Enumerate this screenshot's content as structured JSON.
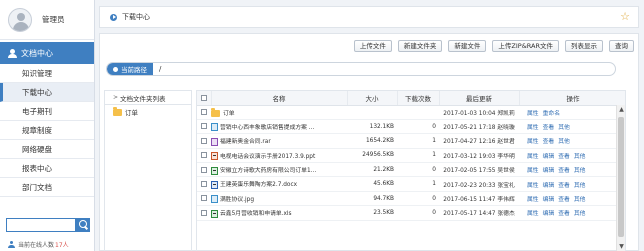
{
  "user": {
    "name": "管理员"
  },
  "sidebar": {
    "section_title": "文档中心",
    "items": [
      {
        "label": "知识管理",
        "active": false
      },
      {
        "label": "下载中心",
        "active": true
      },
      {
        "label": "电子期刊",
        "active": false
      },
      {
        "label": "规章制度",
        "active": false
      },
      {
        "label": "网络硬盘",
        "active": false
      },
      {
        "label": "报表中心",
        "active": false
      },
      {
        "label": "部门文档",
        "active": false
      }
    ],
    "search_placeholder": "",
    "online_label": "当前在线人数",
    "online_count": "17人"
  },
  "breadcrumb": {
    "title": "下载中心"
  },
  "toolbar": {
    "buttons": [
      "上传文件",
      "新建文件夹",
      "新建文件",
      "上传ZIP&RAR文件",
      "列表显示",
      "查询"
    ]
  },
  "path": {
    "label": "当前路径",
    "value": "/"
  },
  "tree": {
    "header": "文档文件夹列表",
    "items": [
      "订单"
    ]
  },
  "table": {
    "headers": [
      "",
      "名称",
      "大小",
      "下载次数",
      "最后更新",
      "操作"
    ],
    "rows": [
      {
        "icon": "folder",
        "name": "订单",
        "size": "",
        "downloads": "",
        "updated": "2017-01-03 10:04",
        "user": "郑凯莉",
        "ops": [
          "属性",
          "重命名"
        ]
      },
      {
        "icon": "img",
        "name": "营销中心西丰象歌店销售提成方案 ...",
        "size": "132.1KB",
        "downloads": "0",
        "updated": "2017-05-21 17:18",
        "user": "赵晓璇",
        "ops": [
          "属性",
          "查看",
          "其他"
        ]
      },
      {
        "icon": "rar",
        "name": "福建新奥金合同.rar",
        "size": "1654.2KB",
        "downloads": "1",
        "updated": "2017-04-27 12:16",
        "user": "赵世君",
        "ops": [
          "属性",
          "查看",
          "其他"
        ]
      },
      {
        "icon": "ppt",
        "name": "电视电话会议演示手册2017.3.9.ppt",
        "size": "24956.5KB",
        "downloads": "1",
        "updated": "2017-03-12 19:03",
        "user": "李华明",
        "ops": [
          "属性",
          "编辑",
          "查看",
          "其他"
        ]
      },
      {
        "icon": "xls",
        "name": "安徽立方诗歌大药房有限公司订单1...",
        "size": "21.2KB",
        "downloads": "0",
        "updated": "2017-02-05 17:55",
        "user": "吴世侯",
        "ops": [
          "属性",
          "编辑",
          "查看",
          "其他"
        ]
      },
      {
        "icon": "doc",
        "name": "王建英蛋乐舞陶方案2.7.docx",
        "size": "45.6KB",
        "downloads": "1",
        "updated": "2017-02-23 20:33",
        "user": "张宝礼",
        "ops": [
          "属性",
          "编辑",
          "查看",
          "其他"
        ]
      },
      {
        "icon": "img",
        "name": "满胜协议.jpg",
        "size": "94.7KB",
        "downloads": "0",
        "updated": "2017-06-15 11:47",
        "user": "李伟辉",
        "ops": [
          "属性",
          "编辑",
          "查看",
          "其他"
        ]
      },
      {
        "icon": "xls",
        "name": "云鑫5月营收销和申请单.xls",
        "size": "23.5KB",
        "downloads": "0",
        "updated": "2017-05-17 14:47",
        "user": "张德杰",
        "ops": [
          "属性",
          "编辑",
          "查看",
          "其他"
        ]
      }
    ]
  },
  "icons": {
    "star": "star-icon",
    "search": "search-icon",
    "folder": "folder-icon"
  },
  "colors": {
    "accent": "#3f7fc1",
    "link": "#2f6db3",
    "online_count": "#d9534f",
    "star": "#e0a93b"
  }
}
